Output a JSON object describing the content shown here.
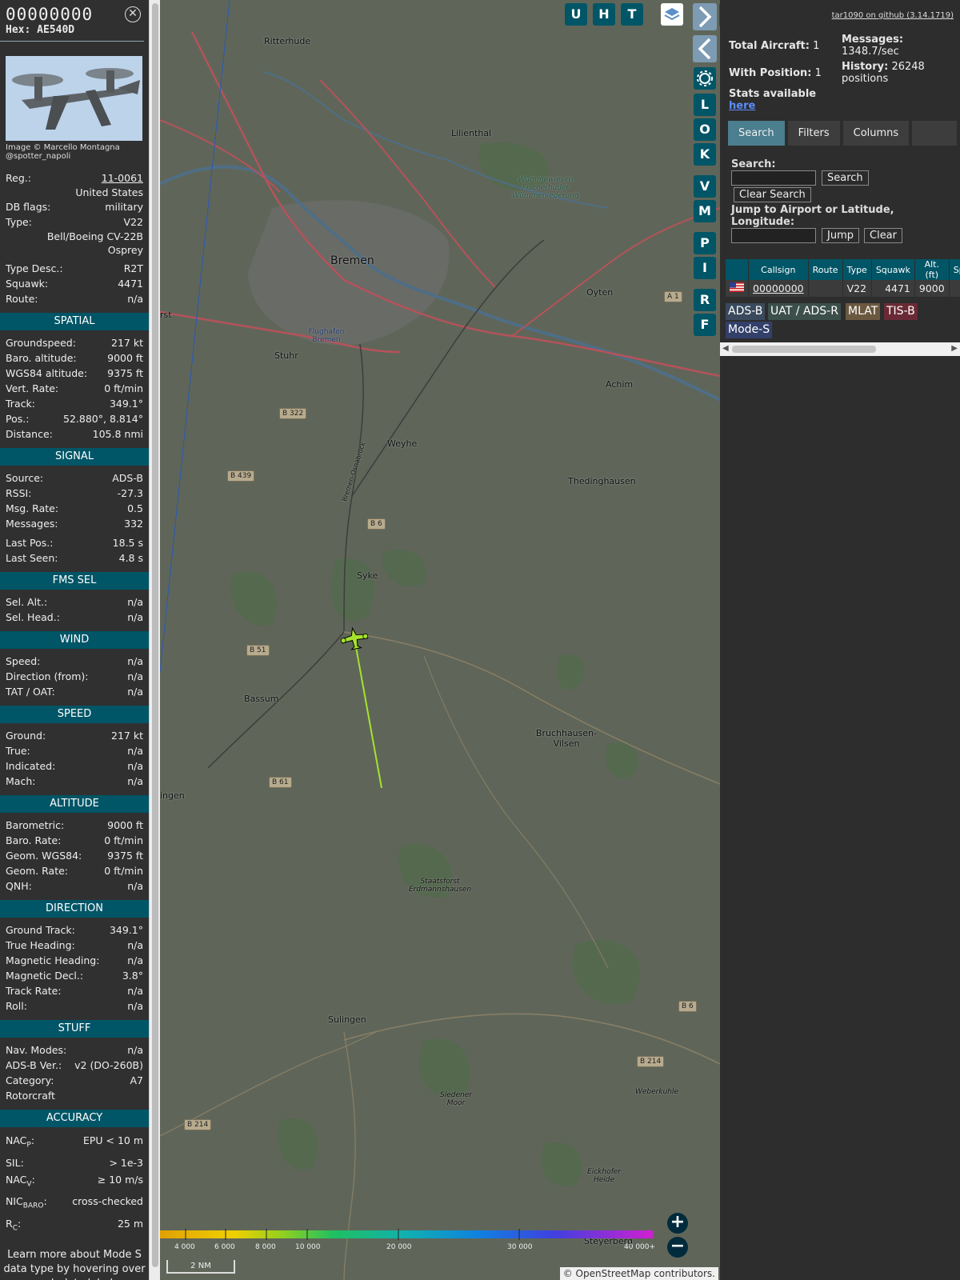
{
  "info": {
    "callsign": "00000000",
    "hex": "Hex: AE540D",
    "photo_credit_1": "Image © Marcello Montagna",
    "photo_credit_2": "@spotter_napoli",
    "reg_label": "Reg.:",
    "reg": "11-0061",
    "country": "United States",
    "dbflags_label": "DB flags:",
    "dbflags": "military",
    "type_label": "Type:",
    "type": "V22",
    "type_name_1": "Bell/Boeing CV-22B",
    "type_name_2": "Osprey",
    "typedesc_label": "Type Desc.:",
    "typedesc": "R2T",
    "squawk_label": "Squawk:",
    "squawk": "4471",
    "route_label": "Route:",
    "route": "n/a"
  },
  "sections": {
    "spatial": "SPATIAL",
    "signal": "SIGNAL",
    "fms": "FMS SEL",
    "wind": "WIND",
    "speed": "SPEED",
    "altitude": "ALTITUDE",
    "direction": "DIRECTION",
    "stuff": "STUFF",
    "accuracy": "ACCURACY"
  },
  "spatial": [
    {
      "k": "Groundspeed:",
      "v": "217 kt"
    },
    {
      "k": "Baro. altitude:",
      "v": "9000 ft"
    },
    {
      "k": "WGS84 altitude:",
      "v": "9375 ft"
    },
    {
      "k": "Vert. Rate:",
      "v": "0 ft/min"
    },
    {
      "k": "Track:",
      "v": "349.1°"
    },
    {
      "k": "Pos.:",
      "v": "52.880°, 8.814°"
    },
    {
      "k": "Distance:",
      "v": "105.8 nmi"
    }
  ],
  "signal": [
    {
      "k": "Source:",
      "v": "ADS-B"
    },
    {
      "k": "RSSI:",
      "v": "-27.3"
    },
    {
      "k": "Msg. Rate:",
      "v": "0.5"
    },
    {
      "k": "Messages:",
      "v": "332"
    }
  ],
  "signal2": [
    {
      "k": "Last Pos.:",
      "v": "18.5 s"
    },
    {
      "k": "Last Seen:",
      "v": "4.8 s"
    }
  ],
  "fms": [
    {
      "k": "Sel. Alt.:",
      "v": "n/a"
    },
    {
      "k": "Sel. Head.:",
      "v": "n/a"
    }
  ],
  "wind": [
    {
      "k": "Speed:",
      "v": "n/a"
    },
    {
      "k": "Direction (from):",
      "v": "n/a"
    },
    {
      "k": "TAT / OAT:",
      "v": "n/a"
    }
  ],
  "speed": [
    {
      "k": "Ground:",
      "v": "217 kt"
    },
    {
      "k": "True:",
      "v": "n/a"
    },
    {
      "k": "Indicated:",
      "v": "n/a"
    },
    {
      "k": "Mach:",
      "v": "n/a"
    }
  ],
  "altitude": [
    {
      "k": "Barometric:",
      "v": "9000 ft"
    },
    {
      "k": "Baro. Rate:",
      "v": "0 ft/min"
    },
    {
      "k": "Geom. WGS84:",
      "v": "9375 ft"
    },
    {
      "k": "Geom. Rate:",
      "v": "0 ft/min"
    },
    {
      "k": "QNH:",
      "v": "n/a"
    }
  ],
  "direction": [
    {
      "k": "Ground Track:",
      "v": "349.1°"
    },
    {
      "k": "True Heading:",
      "v": "n/a"
    },
    {
      "k": "Magnetic Heading:",
      "v": "n/a"
    },
    {
      "k": "Magnetic Decl.:",
      "v": "3.8°"
    },
    {
      "k": "Track Rate:",
      "v": "n/a"
    },
    {
      "k": "Roll:",
      "v": "n/a"
    }
  ],
  "stuff": [
    {
      "k": "Nav. Modes:",
      "v": "n/a"
    },
    {
      "k": "ADS-B Ver.:",
      "v": "v2 (DO-260B)"
    },
    {
      "k": "Category:",
      "v": "A7"
    }
  ],
  "stuff_cat": "Rotorcraft",
  "accuracy": [
    {
      "k": "NAC",
      "sub": "P",
      "v": "EPU < 10 m"
    },
    {
      "k": "SIL:",
      "sub": "",
      "v": "> 1e-3"
    },
    {
      "k": "NAC",
      "sub": "V",
      "v": "≥ 10 m/s"
    },
    {
      "k": "NIC",
      "sub": "BARO",
      "v": "cross-checked"
    },
    {
      "k": "R",
      "sub": "C",
      "v": "25 m"
    }
  ],
  "note": "Learn more about Mode S data type by hovering over each data label.",
  "map": {
    "places": [
      {
        "id": "ritterhude",
        "t": "Ritterhude"
      },
      {
        "id": "lilienthal",
        "t": "Lilienthal"
      },
      {
        "id": "wumme",
        "t": "Wümmewiesen Fischerhuder Wümmeniederung"
      },
      {
        "id": "bremen",
        "t": "Bremen"
      },
      {
        "id": "oyten",
        "t": "Oyten"
      },
      {
        "id": "flughafen",
        "t": "Flughafen Bremen"
      },
      {
        "id": "stuhr",
        "t": "Stuhr"
      },
      {
        "id": "achim",
        "t": "Achim"
      },
      {
        "id": "weyhe",
        "t": "Weyhe"
      },
      {
        "id": "thedinghausen",
        "t": "Thedinghausen"
      },
      {
        "id": "syke",
        "t": "Syke"
      },
      {
        "id": "bassum",
        "t": "Bassum"
      },
      {
        "id": "bruchhausen",
        "t": "Bruchhausen-Vilsen"
      },
      {
        "id": "erdmann",
        "t": "Staatsforst Erdmannshausen"
      },
      {
        "id": "sulingen",
        "t": "Sulingen"
      },
      {
        "id": "weberkuhle",
        "t": "Weberkuhle"
      },
      {
        "id": "siedener",
        "t": "Siedener Moor"
      },
      {
        "id": "eickhofer",
        "t": "Eickhofer Heide"
      },
      {
        "id": "steyerberg",
        "t": "Steyerberg"
      },
      {
        "id": "ingen",
        "t": "ingen"
      },
      {
        "id": "rst",
        "t": "rst"
      },
      {
        "id": "bahn",
        "t": "Bremen-Osnabrück"
      }
    ],
    "roads": [
      "B 322",
      "B 439",
      "B 6",
      "B 51",
      "B 61",
      "B 214",
      "B 214",
      "B 6",
      "A 1"
    ],
    "buttons": [
      "U",
      "H",
      "T",
      "L",
      "O",
      "K",
      "V",
      "M",
      "P",
      "I",
      "R",
      "F"
    ],
    "scale_labels": [
      "4 000",
      "6 000",
      "8 000",
      "10 000",
      "20 000",
      "30 000",
      "40 000+"
    ],
    "scale_nm": "2 NM",
    "attribution_prefix": "©",
    "attribution_link": "OpenStreetMap",
    "attribution_suffix": "contributors."
  },
  "right": {
    "github": "tar1090 on github (3.14.1719)",
    "total_label": "Total Aircraft:",
    "total": "1",
    "withpos_label": "With Position:",
    "withpos": "1",
    "stats_label": "Stats available",
    "stats_link": "here",
    "messages_label": "Messages:",
    "messages": "1348.7/sec",
    "history_label": "History:",
    "history": "26248",
    "history_unit": "positions",
    "tabs": [
      "Search",
      "Filters",
      "Columns"
    ],
    "search_label": "Search:",
    "search_btn": "Search",
    "clear_search_btn": "Clear Search",
    "jump_label": "Jump to Airport or Latitude, Longitude:",
    "jump_btn": "Jump",
    "clear_btn": "Clear",
    "table_headers": [
      "Callsign",
      "Route",
      "Type",
      "Squawk",
      "Alt. (ft)",
      "Sp"
    ],
    "row": {
      "callsign": "00000000",
      "route": "",
      "type": "V22",
      "squawk": "4471",
      "alt": "9000"
    },
    "legend": [
      "ADS-B",
      "UAT / ADS-R",
      "MLAT",
      "TIS-B",
      "Mode-S"
    ]
  },
  "colors": {
    "header_teal": "#005566",
    "track_green": "#a6e22e"
  }
}
